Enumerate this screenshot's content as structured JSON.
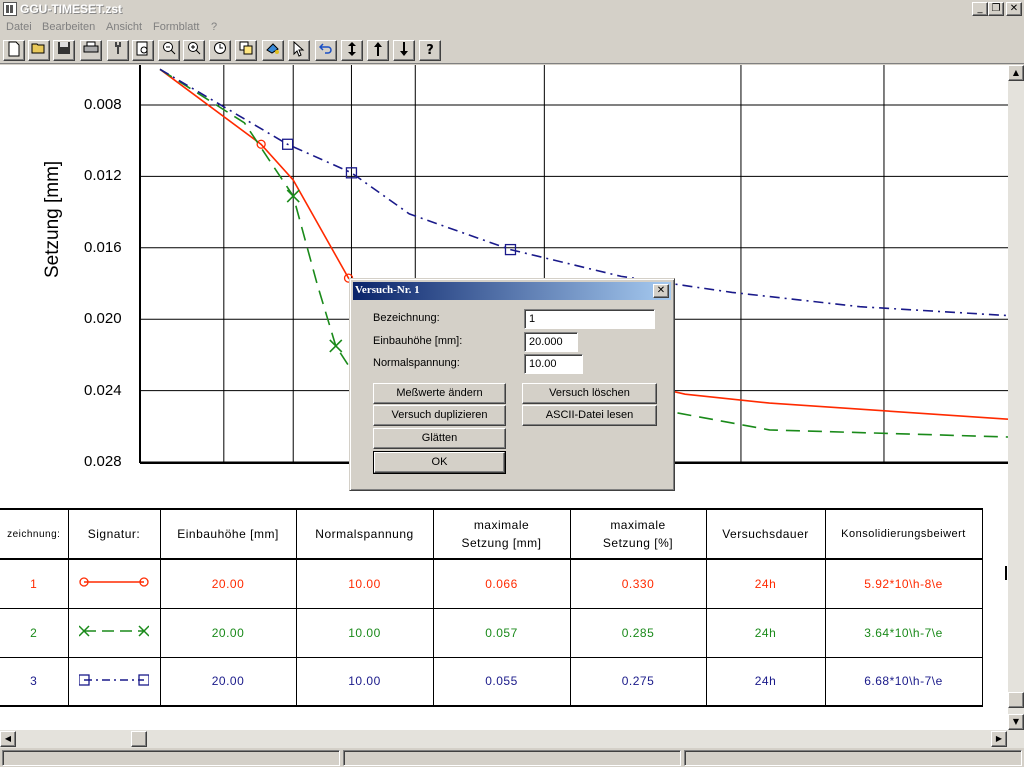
{
  "window": {
    "title": "GGU-TIMESET.zst",
    "minimize": "_",
    "restore": "❐",
    "close": "✕"
  },
  "menu": [
    "Datei",
    "Bearbeiten",
    "Ansicht",
    "Formblatt",
    "?"
  ],
  "toolbar": {
    "icons": [
      "new-file-icon",
      "open-folder-icon",
      "save-icon",
      "print-icon",
      "tools-icon",
      "zoom-page-icon",
      "zoom-out-icon",
      "zoom-in-icon",
      "clock-icon",
      "copy-icon",
      "paint-icon",
      "pointer-icon",
      "undo-icon",
      "move-vertical-icon",
      "arrow-up-icon",
      "arrow-down-icon",
      "help-icon"
    ],
    "help_label": "?"
  },
  "chart_data": {
    "type": "line",
    "ylabel": "Setzung [mm]",
    "yticks": [
      "0.008",
      "0.012",
      "0.016",
      "0.020",
      "0.024",
      "0.028"
    ],
    "ylim": [
      0.006,
      0.028
    ],
    "y_inverted": true,
    "x_scale": "log",
    "grid": true,
    "series": [
      {
        "name": "1",
        "color": "#ff2a00",
        "style": "solid",
        "marker": "circle",
        "points": [
          [
            0.2,
            0.006
          ],
          [
            0.6,
            0.0102
          ],
          [
            0.85,
            0.0122
          ],
          [
            1.55,
            0.0177
          ],
          [
            2.4,
            0.0195
          ],
          [
            4.6,
            0.0208
          ],
          [
            9,
            0.0218
          ],
          [
            20,
            0.0229
          ],
          [
            60,
            0.0242
          ],
          [
            150,
            0.0247
          ],
          [
            2000,
            0.0256
          ]
        ]
      },
      {
        "name": "2",
        "color": "#1a8a1a",
        "style": "dashed",
        "marker": "cross",
        "points": [
          [
            0.2,
            0.006
          ],
          [
            0.5,
            0.009
          ],
          [
            0.85,
            0.0131
          ],
          [
            1.1,
            0.018
          ],
          [
            1.35,
            0.0215
          ],
          [
            1.65,
            0.0231
          ],
          [
            3.2,
            0.0238
          ],
          [
            9,
            0.024
          ],
          [
            25,
            0.0245
          ],
          [
            150,
            0.0262
          ],
          [
            2000,
            0.0266
          ]
        ]
      },
      {
        "name": "3",
        "color": "#1a1a8a",
        "style": "dashdot",
        "marker": "square",
        "points": [
          [
            0.2,
            0.006
          ],
          [
            0.8,
            0.0102
          ],
          [
            1.6,
            0.0118
          ],
          [
            3,
            0.0141
          ],
          [
            9,
            0.0161
          ],
          [
            30,
            0.0176
          ],
          [
            100,
            0.0185
          ],
          [
            400,
            0.0193
          ],
          [
            2000,
            0.0198
          ]
        ]
      }
    ],
    "vlines_x": [
      0.4,
      0.85,
      1.6,
      3.2,
      13,
      110,
      520
    ]
  },
  "table": {
    "headers": [
      "zeichnung:",
      "Signatur:",
      "Einbauhöhe [mm]",
      "Normalspannung",
      "maximale Setzung [mm]",
      "maximale Setzung [%]",
      "Versuchsdauer",
      "Konsolidierungsbeiwert"
    ],
    "rows": [
      {
        "nr": "1",
        "color": "#ff2a00",
        "einbauhoehe": "20.00",
        "normalspannung": "10.00",
        "setzung_mm": "0.066",
        "setzung_pct": "0.330",
        "dauer": "24h",
        "konsolidierung": "5.92*10\\h-8\\e"
      },
      {
        "nr": "2",
        "color": "#1a8a1a",
        "einbauhoehe": "20.00",
        "normalspannung": "10.00",
        "setzung_mm": "0.057",
        "setzung_pct": "0.285",
        "dauer": "24h",
        "konsolidierung": "3.64*10\\h-7\\e"
      },
      {
        "nr": "3",
        "color": "#1a1a8a",
        "einbauhoehe": "20.00",
        "normalspannung": "10.00",
        "setzung_mm": "0.055",
        "setzung_pct": "0.275",
        "dauer": "24h",
        "konsolidierung": "6.68*10\\h-7\\e"
      }
    ]
  },
  "dialog": {
    "title": "Versuch-Nr. 1",
    "close": "✕",
    "bezeichnung_label": "Bezeichnung:",
    "bezeichnung_value": "1",
    "einbauhoehe_label": "Einbauhöhe [mm]:",
    "einbauhoehe_value": "20.000",
    "normalspannung_label": "Normalspannung:",
    "normalspannung_value": "10.00",
    "buttons": {
      "messwerte": "Meßwerte ändern",
      "loeschen": "Versuch löschen",
      "duplizieren": "Versuch duplizieren",
      "ascii": "ASCII-Datei lesen",
      "glaetten": "Glätten",
      "ok": "OK"
    }
  },
  "scroll": {
    "up": "▲",
    "down": "▼",
    "left": "◀",
    "right": "▶"
  }
}
